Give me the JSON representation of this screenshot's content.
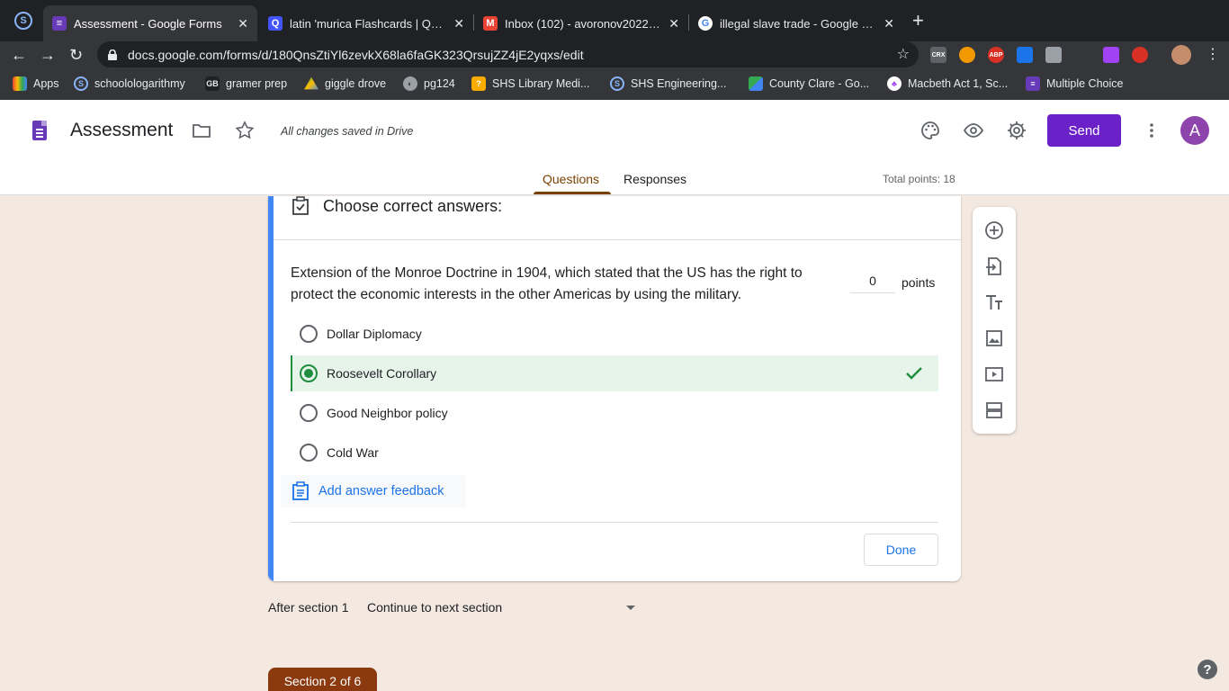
{
  "browser": {
    "tabs": [
      {
        "title": "Assessment - Google Forms",
        "icon": "google-forms-icon",
        "color": "#673ab7"
      },
      {
        "title": "latin 'murica Flashcards | Quizlet",
        "icon": "quizlet-icon",
        "color": "#4255ff"
      },
      {
        "title": "Inbox (102) - avoronov2022@s",
        "icon": "gmail-icon",
        "color": "#ea4335"
      },
      {
        "title": "illegal slave trade - Google Search",
        "icon": "google-icon",
        "color": "#4285f4"
      }
    ],
    "new_tab_label": "+",
    "url": "docs.google.com/forms/d/180QnsZtiYl6zevkX68la6faGK323QrsujZZ4jE2yqxs/edit",
    "extensions": [
      "CRX",
      "ABP"
    ],
    "bookmarks": [
      {
        "label": "Apps",
        "icon": "apps-grid-icon",
        "color": "#ea4335"
      },
      {
        "label": "schoolologarithmy",
        "icon": "schoology-icon",
        "color": "#8ab4f8"
      },
      {
        "label": "gramer prep",
        "icon": "gb-icon",
        "color": "#202124"
      },
      {
        "label": "giggle drove",
        "icon": "google-drive-icon",
        "color": "#fbbc04"
      },
      {
        "label": "pg124",
        "icon": "globe-icon",
        "color": "#9aa0a6"
      },
      {
        "label": "SHS Library Medi...",
        "icon": "library-icon",
        "color": "#f9ab00"
      },
      {
        "label": "SHS Engineering...",
        "icon": "schoology-icon",
        "color": "#8ab4f8"
      },
      {
        "label": "County Clare - Go...",
        "icon": "maps-icon",
        "color": "#34a853"
      },
      {
        "label": "Macbeth Act 1, Sc...",
        "icon": "macbeth-icon",
        "color": "#ffffff"
      },
      {
        "label": "Multiple Choice",
        "icon": "google-forms-icon",
        "color": "#673ab7"
      }
    ]
  },
  "header": {
    "title": "Assessment",
    "saved_status": "All changes saved in Drive",
    "send_label": "Send",
    "avatar_initial": "A",
    "tabs": [
      "Questions",
      "Responses"
    ],
    "total_points": "Total points: 18"
  },
  "question": {
    "answer_key_heading": "Choose correct answers:",
    "text": "Extension of the Monroe Doctrine in 1904, which stated that the US has the right to protect the economic interests in the other Americas by using the military.",
    "points_value": "0",
    "points_label": "points",
    "options": [
      {
        "label": "Dollar Diplomacy",
        "correct": false
      },
      {
        "label": "Roosevelt Corollary",
        "correct": true
      },
      {
        "label": "Good Neighbor policy",
        "correct": false
      },
      {
        "label": "Cold War",
        "correct": false
      }
    ],
    "feedback_label": "Add answer feedback",
    "done_label": "Done"
  },
  "after_section": {
    "label": "After section 1",
    "value": "Continue to next section"
  },
  "section_badge": "Section 2 of 6",
  "help_label": "?",
  "colors": {
    "accent": "#6b21c8",
    "tab_accent": "#7b3f00",
    "correct": "#1e8e3e",
    "card_bar": "#4285f4",
    "page_bg": "#f4e9e1"
  }
}
